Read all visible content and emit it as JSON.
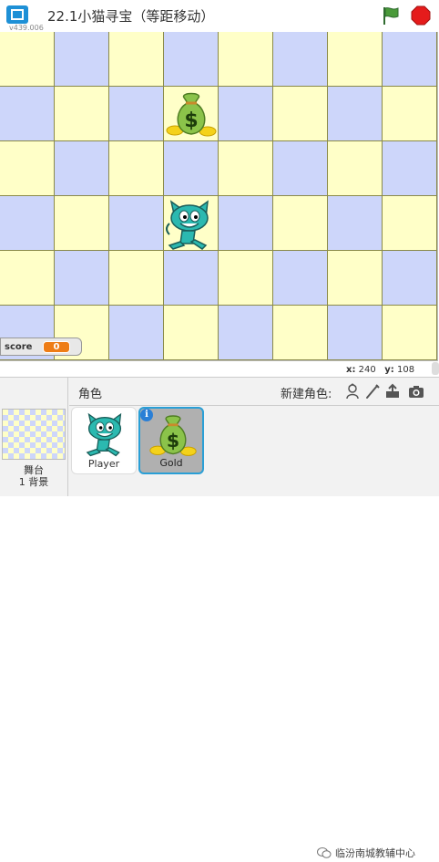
{
  "header": {
    "title": "22.1小猫寻宝（等距移动）",
    "version": "v439.006"
  },
  "stage": {
    "score_monitor": {
      "label": "score",
      "value": "0"
    },
    "mouse_x_label": "x:",
    "mouse_x": "240",
    "mouse_y_label": "y:",
    "mouse_y": "108",
    "colors": {
      "yellow": "#ffffc8",
      "blue": "#cdd6fa",
      "grid_line": "#8a8a4a"
    }
  },
  "sprite_pane": {
    "title": "角色",
    "new_sprite_label": "新建角色:",
    "stage_label": "舞台",
    "stage_backdrops": "1 背景",
    "sprites": [
      {
        "name": "Player",
        "icon": "cat-sprite-icon"
      },
      {
        "name": "Gold",
        "icon": "money-bag-icon",
        "selected": true
      }
    ],
    "info_badge": "i"
  },
  "watermark": "临汾南城教辅中心"
}
